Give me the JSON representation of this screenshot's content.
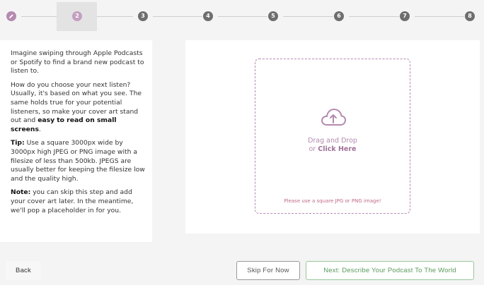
{
  "stepper": {
    "steps": [
      {
        "label": "",
        "state": "done"
      },
      {
        "label": "2",
        "state": "current"
      },
      {
        "label": "3",
        "state": "pending"
      },
      {
        "label": "4",
        "state": "pending"
      },
      {
        "label": "5",
        "state": "pending"
      },
      {
        "label": "6",
        "state": "pending"
      },
      {
        "label": "7",
        "state": "pending"
      },
      {
        "label": "8",
        "state": "pending"
      }
    ]
  },
  "info": {
    "p1": "Imagine swiping through Apple Podcasts or Spotify to find a brand new podcast to listen to.",
    "p2_text": "How do you choose your next listen? Usually, it's based on what you see. The same holds true for your potential listeners, so make your cover art stand out and ",
    "p2_bold": "easy to read on small screens",
    "p2_end": ".",
    "tip_label": "Tip:",
    "tip_text": " Use a square 3000px wide by 3000px high JPEG or PNG image with a filesize of less than 500kb. JPEGS are usually better for keeping the filesize low and the quality high.",
    "note_label": "Note:",
    "note_text": " you can skip this step and add your cover art later. In the meantime, we'll pop a placeholder in for you."
  },
  "upload": {
    "line1": "Drag and Drop",
    "or": "or ",
    "click_here": "Click Here",
    "hint": "Please use a square JPG or PNG image!"
  },
  "footer": {
    "back": "Back",
    "skip": "Skip For Now",
    "next": "Next: Describe Your Podcast To The World"
  },
  "colors": {
    "accent": "#b48ab0",
    "next_green": "#5a9a5a"
  },
  "icons": {
    "done_step": "pencil-icon",
    "upload": "cloud-upload-icon"
  }
}
